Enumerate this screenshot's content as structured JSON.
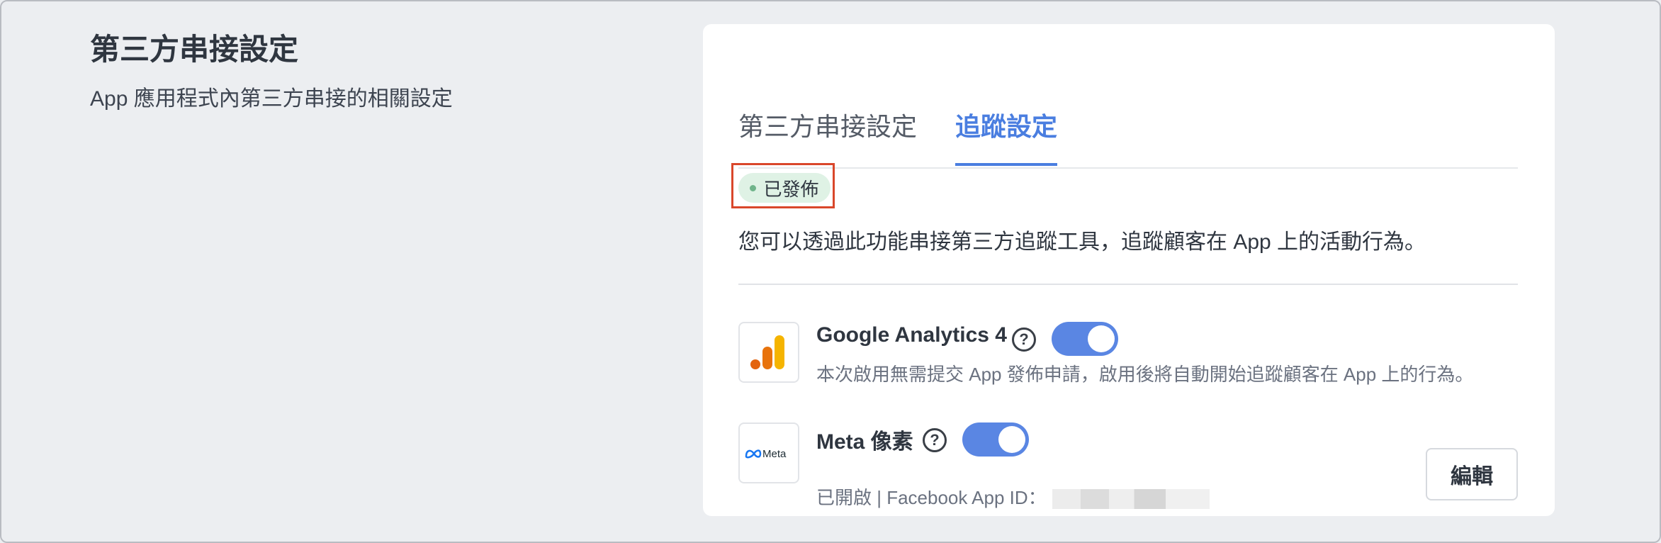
{
  "section": {
    "title": "第三方串接設定",
    "description": "App 應用程式內第三方串接的相關設定"
  },
  "tabs": [
    {
      "label": "第三方串接設定",
      "active": false
    },
    {
      "label": "追蹤設定",
      "active": true
    }
  ],
  "status": {
    "label": "已發佈",
    "color": "#dff2e5"
  },
  "feature_description": "您可以透過此功能串接第三方追蹤工具，追蹤顧客在 App 上的活動行為。",
  "integrations": [
    {
      "name": "Google Analytics 4",
      "icon": "google-analytics-icon",
      "enabled": true,
      "subtext": "本次啟用無需提交 App 發佈申請，啟用後將自動開始追蹤顧客在 App 上的行為。"
    },
    {
      "name": "Meta 像素",
      "icon": "meta-logo-icon",
      "logo_text": "Meta",
      "enabled": true,
      "subtext": "已開啟 | Facebook App ID：",
      "edit_label": "編輯"
    }
  ],
  "colors": {
    "accent": "#4a7ee0",
    "toggle_on": "#5a86e3",
    "highlight_outline": "#d9472b"
  }
}
